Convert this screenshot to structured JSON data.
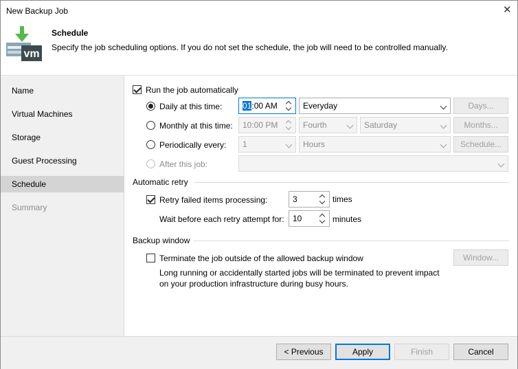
{
  "window": {
    "title": "New Backup Job",
    "close_glyph": "✕"
  },
  "header": {
    "title": "Schedule",
    "description": "Specify the job scheduling options. If you do not set the schedule, the job will need to be controlled manually.",
    "icon": "backup-vm-icon",
    "icon_text": "vm"
  },
  "sidebar": {
    "items": [
      {
        "label": "Name",
        "state": "normal"
      },
      {
        "label": "Virtual Machines",
        "state": "normal"
      },
      {
        "label": "Storage",
        "state": "normal"
      },
      {
        "label": "Guest Processing",
        "state": "normal"
      },
      {
        "label": "Schedule",
        "state": "active"
      },
      {
        "label": "Summary",
        "state": "disabled"
      }
    ]
  },
  "schedule": {
    "run_auto": {
      "label": "Run the job automatically",
      "checked": true
    },
    "daily": {
      "label": "Daily at this time:",
      "selected": true,
      "time_hour": "01",
      "time_rest": ":00 AM",
      "freq": "Everyday",
      "button": "Days..."
    },
    "monthly": {
      "label": "Monthly at this time:",
      "selected": false,
      "time": "10:00 PM",
      "week": "Fourth",
      "day": "Saturday",
      "button": "Months..."
    },
    "periodic": {
      "label": "Periodically every:",
      "selected": false,
      "value": "1",
      "unit": "Hours",
      "button": "Schedule..."
    },
    "after": {
      "label": "After this job:",
      "selected": false,
      "value": ""
    }
  },
  "retry": {
    "heading": "Automatic retry",
    "retry_label": "Retry failed items processing:",
    "retry_checked": true,
    "retry_value": "3",
    "retry_unit": "times",
    "wait_label": "Wait before each retry attempt for:",
    "wait_value": "10",
    "wait_unit": "minutes"
  },
  "backup_window": {
    "heading": "Backup window",
    "terminate_label": "Terminate the job outside of the allowed backup window",
    "terminate_checked": false,
    "note_line1": "Long running or accidentally started jobs will be terminated to prevent impact",
    "note_line2": "on your production infrastructure during busy hours.",
    "button": "Window..."
  },
  "footer": {
    "previous": "< Previous",
    "apply": "Apply",
    "finish": "Finish",
    "cancel": "Cancel"
  },
  "colors": {
    "accent": "#0078d7",
    "veeam_green": "#54b948",
    "sidebar_bg": "#f0f0f0"
  }
}
